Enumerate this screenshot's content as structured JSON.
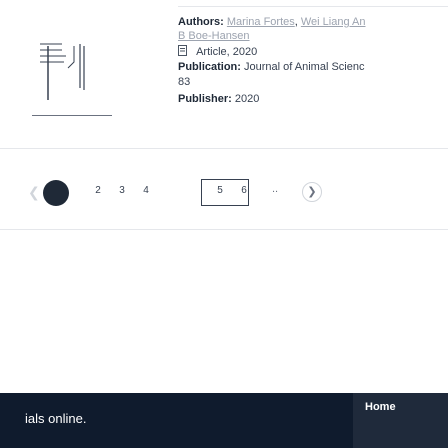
{
  "record": {
    "authors_label": "Authors:",
    "authors": [
      "Marina Fortes",
      "Wei Liang An",
      "B Boe-Hansen"
    ],
    "author_sep": ",",
    "type_value": "Article, 2020",
    "publication_label": "Publication:",
    "publication_value": "Journal of Animal Scienc",
    "publication_line2": "83",
    "publisher_label": "Publisher:",
    "publisher_value": "2020"
  },
  "pager": {
    "pages": [
      "2",
      "3",
      "4",
      "5",
      "6"
    ],
    "ellipsis": "..",
    "next_icon": "chevron-right-icon",
    "prev_icon": "chevron-left-icon"
  },
  "footer": {
    "text": "ials online.",
    "home_label": "Home"
  },
  "colors": {
    "footer_bg": "#0f1b2d",
    "link": "#9ca3af",
    "dark": "#1f2937"
  }
}
